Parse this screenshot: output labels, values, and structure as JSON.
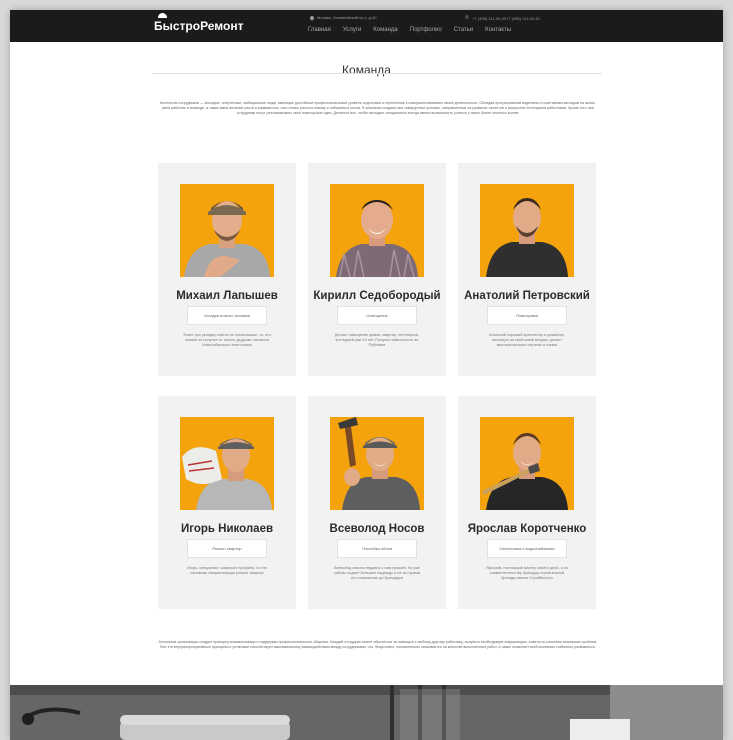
{
  "header": {
    "logo": "БыстроРемонт",
    "address": "Москва, Олимпийский пр-т, д.40",
    "phones": "+7 (495) 111-00-40+7 (495) 111-00-40",
    "nav": [
      "Главная",
      "Услуги",
      "Команда",
      "Портфолио",
      "Статьи",
      "Контакты"
    ]
  },
  "page": {
    "title": "Команда",
    "intro": "Коллектив сотрудников — молодые, энергичные, амбициозные люди, имеющие достойный профессиональный уровень подготовки и стремление к совершенствованию своей деятельности. Обладая прогрессивным видением и позитивным взглядом на жизнь, умея работать в команде, а также имея желание расти и развиваться, они готовы учиться новому и набираться опыта. В компании созданы все комфортные условия, направленные на развитие талантов и раскрытие потенциала работников. Кроме того, все сотрудники могут реализовывать свои новаторские идеи. Делается все, чтобы молодые специалисты всегда имели возможность учиться у своих более опытных коллег.",
    "footer": "Коллектив организации следует принципу взаимопомощи и поддержки профессионального общения. Каждый сотрудник может обратиться за помощью к любому другому работнику, получить необходимую информацию, советы по решению возникших проблем. Все эти внутрикорпоративные принципы и установки способствуют максимальному взаимодействию между сотрудниками, что, безусловно, положительно сказывается на качестве выполненных работ, а также позволяет всей компании стабильно развиваться."
  },
  "team": [
    {
      "name": "Михаил Лапышев",
      "role": "Укладка плитки, мозаики",
      "desc": "Знает про укладку плитки не понаслышке, т.к. его знания он получил от своего дедушки, великого Новосибирского плиточника"
    },
    {
      "name": "Кирилл Седобородый",
      "role": "Освещение",
      "desc": "Делает освещение домов, квартир, пентхаусов, коттеджей уже 10 лет. Получил известность на Рублевке"
    },
    {
      "name": "Анатолий Петровский",
      "role": "Планировка",
      "desc": "Анатолий хороший архитектор и дизайнер, несмотря на свой юный возраст делает высококлассные чертежи и схемы"
    },
    {
      "name": "Игорь Николаев",
      "role": "Ремонт квартир",
      "desc": "Игорь, специалист широкого профиля, но его основная специализация ремонт квартир"
    },
    {
      "name": "Всеволод Носов",
      "role": "Поклейка обоев",
      "desc": "Всеволод совсем недавно к нам пришёл, но уже сейчас подает большие надежды и не за горами его повышение до бригадира"
    },
    {
      "name": "Ярослав Коротченко",
      "role": "Сантехника и водоснабжение",
      "desc": "Ярослав, настоящий мастер своего дела, а по совместительству бригадир строительной бригады имени Стройбыстро"
    }
  ],
  "colors": {
    "topbar": "#1b1b1b",
    "photo_bg": "#f4a30c",
    "card_bg": "#f2f2f2"
  }
}
